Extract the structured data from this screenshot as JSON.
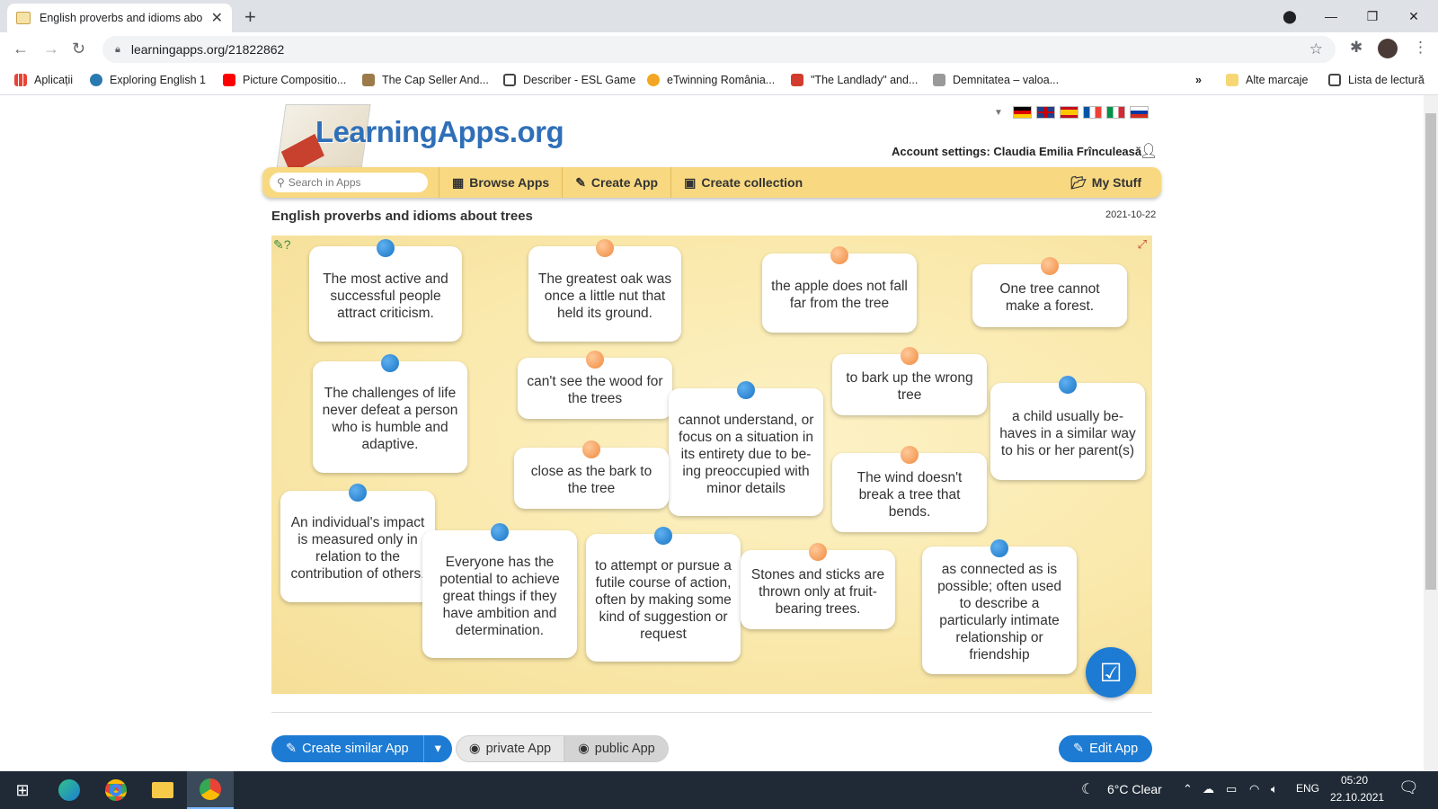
{
  "browser": {
    "tab_title": "English proverbs and idioms abo",
    "url": "learningapps.org/21822862",
    "bookmarks": [
      {
        "label": "Aplicații",
        "color": "#4285f4"
      },
      {
        "label": "Exploring English 1",
        "color": "#2a7ab0"
      },
      {
        "label": "Picture Compositio...",
        "color": "#ff0000"
      },
      {
        "label": "The Cap Seller And...",
        "color": "#9b7b4a"
      },
      {
        "label": "Describer - ESL Game",
        "color": "#444444"
      },
      {
        "label": "eTwinning România...",
        "color": "#f3a623"
      },
      {
        "label": "\"The Landlady\" and...",
        "color": "#d33b2c"
      },
      {
        "label": "Demnitatea – valoa...",
        "color": "#999999"
      }
    ],
    "bookmarks_more": "»",
    "other_bookmarks": "Alte marcaje",
    "reading_list": "Lista de lectură"
  },
  "site": {
    "logo": "LearningApps.org",
    "account": "Account settings: Claudia Emilia Frînculeasă",
    "search_placeholder": "Search in Apps",
    "menu": {
      "browse": "Browse Apps",
      "create": "Create App",
      "collection": "Create collection",
      "mystuff": "My Stuff"
    },
    "flags": [
      "de",
      "gb",
      "es",
      "fr",
      "it",
      "ru"
    ]
  },
  "app": {
    "title": "English proverbs and idioms about trees",
    "date": "2021-10-22",
    "cards": [
      {
        "text": "The most active and successful people attract criticism.",
        "pin": "blue"
      },
      {
        "text": "The greatest oak was once a little nut that held its ground.",
        "pin": "orange"
      },
      {
        "text": "the apple does not fall far from the tree",
        "pin": "orange"
      },
      {
        "text": "One tree cannot make a forest.",
        "pin": "orange"
      },
      {
        "text": "The challenges of life never defeat a person who is humble and adaptive.",
        "pin": "blue"
      },
      {
        "text": "can't see the wood for the trees",
        "pin": "orange"
      },
      {
        "text": "cannot under­stand, or focus on a situation in its entirety due to be­ing preoccupied with minor details",
        "pin": "blue"
      },
      {
        "text": "to bark up the wrong tree",
        "pin": "orange"
      },
      {
        "text": "a child usually be­haves in a similar way to his or her parent(s)",
        "pin": "blue"
      },
      {
        "text": "close as the bark to the tree",
        "pin": "orange"
      },
      {
        "text": "The wind doesn't break a tree that bends.",
        "pin": "orange"
      },
      {
        "text": "An individual's im­pact is measured only in relation to the contribution of others.",
        "pin": "blue"
      },
      {
        "text": "Everyone has the potential to achieve great things if they have ambition and determination.",
        "pin": "blue"
      },
      {
        "text": "to attempt or pur­sue a futile course of action, often by making some kind of suggestion or request",
        "pin": "blue"
      },
      {
        "text": "Stones and sticks are thrown only at fruit-bearing trees.",
        "pin": "orange"
      },
      {
        "text": "as connected as is possible; often used to describe a particularly inti­mate relationship or friendship",
        "pin": "blue"
      }
    ],
    "buttons": {
      "create_similar": "Create similar App",
      "private": "private App",
      "public": "public App",
      "edit": "Edit App"
    }
  },
  "taskbar": {
    "weather": "6°C  Clear",
    "lang": "ENG",
    "time": "05:20",
    "date": "22.10.2021"
  }
}
